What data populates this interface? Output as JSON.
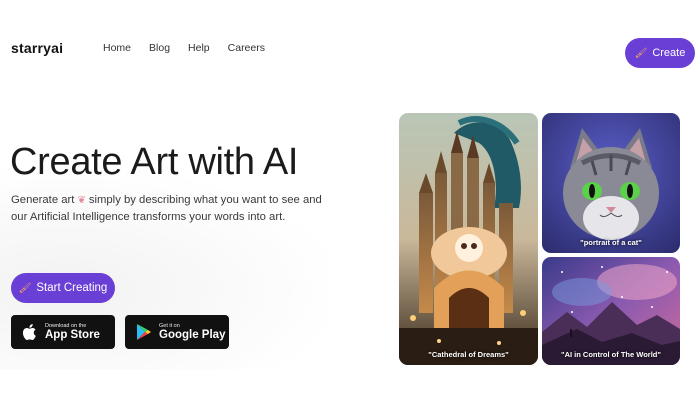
{
  "header": {
    "logo": "starryai",
    "nav": [
      "Home",
      "Blog",
      "Help",
      "Careers"
    ],
    "create_label": "Create"
  },
  "hero": {
    "title": "Create Art with AI",
    "subtitle_part1": "Generate art",
    "subtitle_part2": "simply by describing what you want to see and our Artificial Intelligence transforms your words into art.",
    "start_label": "Start Creating"
  },
  "stores": {
    "apple_small": "Download on the",
    "apple_big": "App Store",
    "google_small": "Get it on",
    "google_big": "Google Play"
  },
  "gallery": {
    "cathedral": "\"Cathedral of Dreams\"",
    "cat": "\"portrait of a cat\"",
    "world": "\"AI in Control of The World\""
  },
  "colors": {
    "accent": "#6a3fd6"
  }
}
